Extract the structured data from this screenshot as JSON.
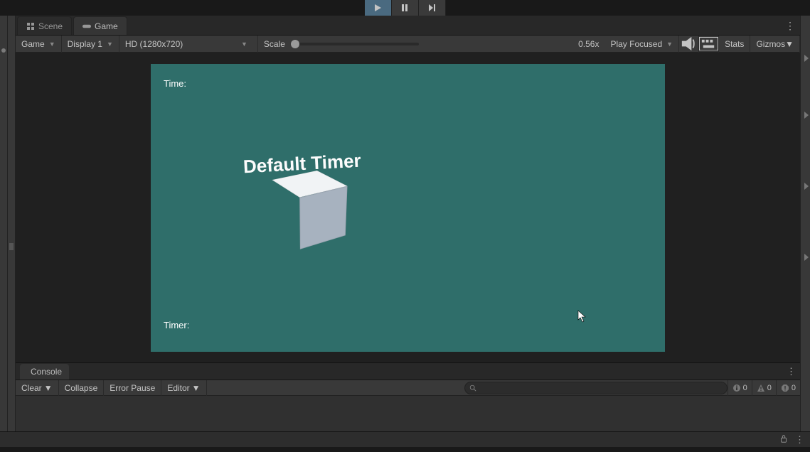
{
  "play_controls": {
    "play": "play",
    "pause": "pause",
    "step": "step"
  },
  "tabs": {
    "scene": "Scene",
    "game": "Game"
  },
  "toolbar": {
    "camera": "Game",
    "display": "Display 1",
    "aspect": "HD (1280x720)",
    "scale_label": "Scale",
    "scale_value": "0.56x",
    "play_mode": "Play Focused",
    "stats": "Stats",
    "gizmos": "Gizmos"
  },
  "viewport": {
    "time_label": "Time:",
    "timer_label": "Timer:",
    "title": "Default Timer"
  },
  "console": {
    "tab": "Console",
    "clear": "Clear",
    "collapse": "Collapse",
    "error_pause": "Error Pause",
    "editor": "Editor",
    "counts": {
      "info": "0",
      "warn": "0",
      "error": "0"
    }
  }
}
